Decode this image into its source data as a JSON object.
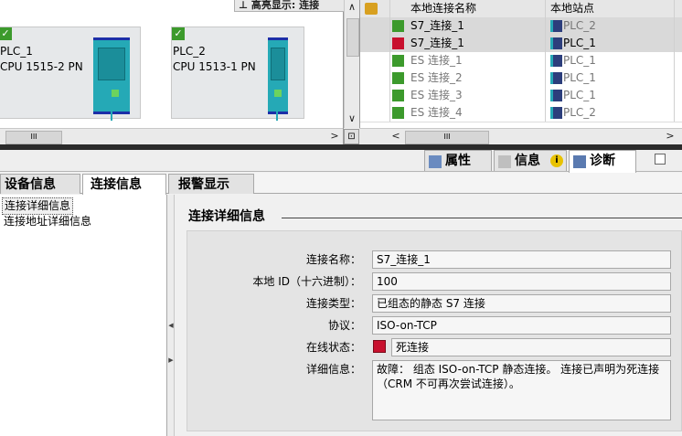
{
  "network": {
    "highlight_label": "高亮显示: 连接",
    "devices": [
      {
        "name": "PLC_1",
        "cpu": "CPU 1515-2 PN"
      },
      {
        "name": "PLC_2",
        "cpu": "CPU 1513-1 PN"
      }
    ],
    "scroll_thumb_label": "III"
  },
  "connection_table": {
    "headers": {
      "name": "本地连接名称",
      "station": "本地站点"
    },
    "rows": [
      {
        "name": "S7_连接_1",
        "station": "PLC_2",
        "status": "ok"
      },
      {
        "name": "S7_连接_1",
        "station": "PLC_1",
        "status": "error"
      },
      {
        "name": "ES 连接_1",
        "station": "PLC_1",
        "status": "ok"
      },
      {
        "name": "ES 连接_2",
        "station": "PLC_1",
        "status": "ok"
      },
      {
        "name": "ES 连接_3",
        "station": "PLC_1",
        "status": "ok"
      },
      {
        "name": "ES 连接_4",
        "station": "PLC_2",
        "status": "ok"
      }
    ],
    "scroll_thumb_label": "III"
  },
  "inspector": {
    "tabs": [
      {
        "label": "属性",
        "icon": "properties-icon"
      },
      {
        "label": "信息",
        "icon": "info-icon"
      },
      {
        "label": "诊断",
        "icon": "diagnostics-icon"
      }
    ],
    "subtabs": [
      "设备信息",
      "连接信息",
      "报警显示"
    ]
  },
  "nav": {
    "items": [
      "连接详细信息",
      "连接地址详细信息"
    ]
  },
  "section": {
    "title": "连接详细信息"
  },
  "form": {
    "fields": [
      {
        "label": "连接名称：",
        "value": "S7_连接_1"
      },
      {
        "label": "本地 ID（十六进制）：",
        "value": "100"
      },
      {
        "label": "连接类型：",
        "value": "已组态的静态 S7 连接"
      },
      {
        "label": "协议：",
        "value": "ISO-on-TCP"
      },
      {
        "label": "在线状态：",
        "value": "死连接"
      },
      {
        "label": "详细信息：",
        "value": "故障： 组态 ISO-on-TCP 静态连接。 连接已声明为死连接（CRM 不可再次尝试连接）。"
      }
    ]
  },
  "colors": {
    "ok_green": "#3c9a2c",
    "error_red": "#c8102e",
    "module_teal": "#25a9b6"
  }
}
